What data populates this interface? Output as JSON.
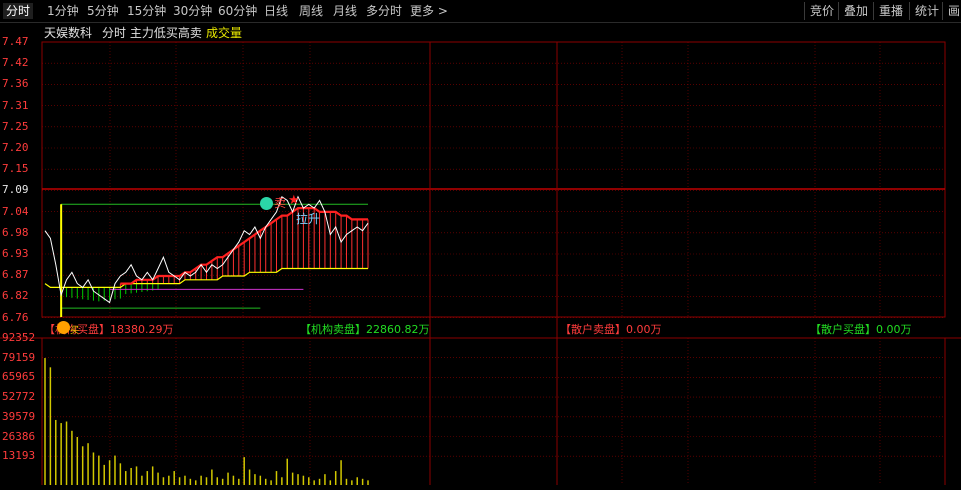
{
  "toolbar": {
    "tabs": [
      "分时",
      "1分钟",
      "5分钟",
      "15分钟",
      "30分钟",
      "60分钟",
      "日线",
      "周线",
      "月线",
      "多分时",
      "更多 >"
    ],
    "right_buttons": [
      "竞价",
      "叠加",
      "重播",
      "统计",
      "画"
    ]
  },
  "header": {
    "stock_name": "天娱数科",
    "indicator_label": "分时 主力低买高卖",
    "volume_label": "成交量"
  },
  "price_axis": [
    "7.47",
    "7.42",
    "7.36",
    "7.31",
    "7.25",
    "7.20",
    "7.15",
    "7.09",
    "7.04",
    "6.98",
    "6.93",
    "6.87",
    "6.82",
    "6.76"
  ],
  "volume_axis": [
    "92352",
    "79159",
    "65965",
    "52772",
    "39579",
    "26386",
    "13193"
  ],
  "legend": {
    "inst_buy": "【机构买盘】18380.29万",
    "inst_sell": "【机构卖盘】22860.82万",
    "retail_sell": "【散户卖盘】0.00万",
    "retail_buy": "【散户买盘】0.00万"
  },
  "markers": {
    "sell": "卖",
    "lift": "拉升",
    "buy": "买"
  },
  "colors": {
    "grid": "#8b0000",
    "price_line": "#ffffff",
    "avg_line": "#ffff00",
    "main_line": "#ff2020",
    "volume_bar": "#d2c800",
    "green": "#00cc00",
    "magenta": "#cc33cc"
  },
  "chart_data": {
    "type": "line",
    "ylim": [
      6.76,
      7.47
    ],
    "price": [
      6.97,
      6.95,
      6.88,
      6.8,
      6.84,
      6.86,
      6.83,
      6.82,
      6.84,
      6.81,
      6.8,
      6.79,
      6.78,
      6.83,
      6.85,
      6.86,
      6.88,
      6.85,
      6.84,
      6.86,
      6.84,
      6.87,
      6.9,
      6.86,
      6.85,
      6.84,
      6.86,
      6.85,
      6.86,
      6.88,
      6.86,
      6.88,
      6.87,
      6.88,
      6.9,
      6.92,
      6.94,
      6.97,
      6.96,
      6.98,
      6.95,
      6.98,
      7.0,
      7.02,
      7.06,
      7.05,
      7.02,
      7.06,
      7.03,
      7.04,
      7.03,
      7.05,
      7.02,
      6.96,
      6.98,
      6.94,
      6.96,
      6.97,
      6.98,
      6.97,
      6.99
    ],
    "avg": [
      6.83,
      6.82,
      6.82,
      6.82,
      6.82,
      6.82,
      6.82,
      6.82,
      6.82,
      6.82,
      6.82,
      6.82,
      6.82,
      6.82,
      6.82,
      6.83,
      6.83,
      6.83,
      6.83,
      6.83,
      6.83,
      6.83,
      6.83,
      6.83,
      6.83,
      6.83,
      6.84,
      6.84,
      6.84,
      6.84,
      6.84,
      6.84,
      6.84,
      6.85,
      6.85,
      6.85,
      6.85,
      6.85,
      6.86,
      6.86,
      6.86,
      6.86,
      6.86,
      6.86,
      6.87,
      6.87,
      6.87,
      6.87,
      6.87,
      6.87,
      6.87,
      6.87,
      6.87,
      6.87,
      6.87,
      6.87,
      6.87,
      6.87,
      6.87,
      6.87,
      6.87
    ],
    "main": [
      null,
      null,
      null,
      null,
      null,
      null,
      null,
      null,
      null,
      null,
      null,
      null,
      null,
      null,
      6.83,
      6.83,
      6.83,
      6.84,
      6.84,
      6.84,
      6.84,
      6.85,
      6.85,
      6.85,
      6.85,
      6.85,
      6.86,
      6.86,
      6.87,
      6.88,
      6.88,
      6.89,
      6.9,
      6.9,
      6.91,
      6.92,
      6.93,
      6.94,
      6.95,
      6.96,
      6.97,
      6.98,
      6.99,
      7.0,
      7.01,
      7.01,
      7.02,
      7.03,
      7.03,
      7.03,
      7.03,
      7.02,
      7.02,
      7.02,
      7.02,
      7.01,
      7.01,
      7.0,
      7.0,
      7.0,
      7.0
    ],
    "volume": [
      82000,
      76000,
      42000,
      40000,
      41000,
      35000,
      31000,
      25000,
      27000,
      21000,
      19000,
      13000,
      16000,
      19000,
      14000,
      9000,
      11000,
      12000,
      6000,
      9000,
      12000,
      8000,
      5000,
      6000,
      9000,
      5000,
      6000,
      4000,
      3000,
      6000,
      5000,
      10000,
      5000,
      4000,
      8000,
      6000,
      4000,
      18000,
      10000,
      7000,
      6000,
      4000,
      3000,
      9000,
      5000,
      17000,
      8000,
      7000,
      6000,
      5000,
      3000,
      4000,
      7000,
      3000,
      9000,
      16000,
      4000,
      3000,
      5000,
      4000,
      3000
    ]
  }
}
